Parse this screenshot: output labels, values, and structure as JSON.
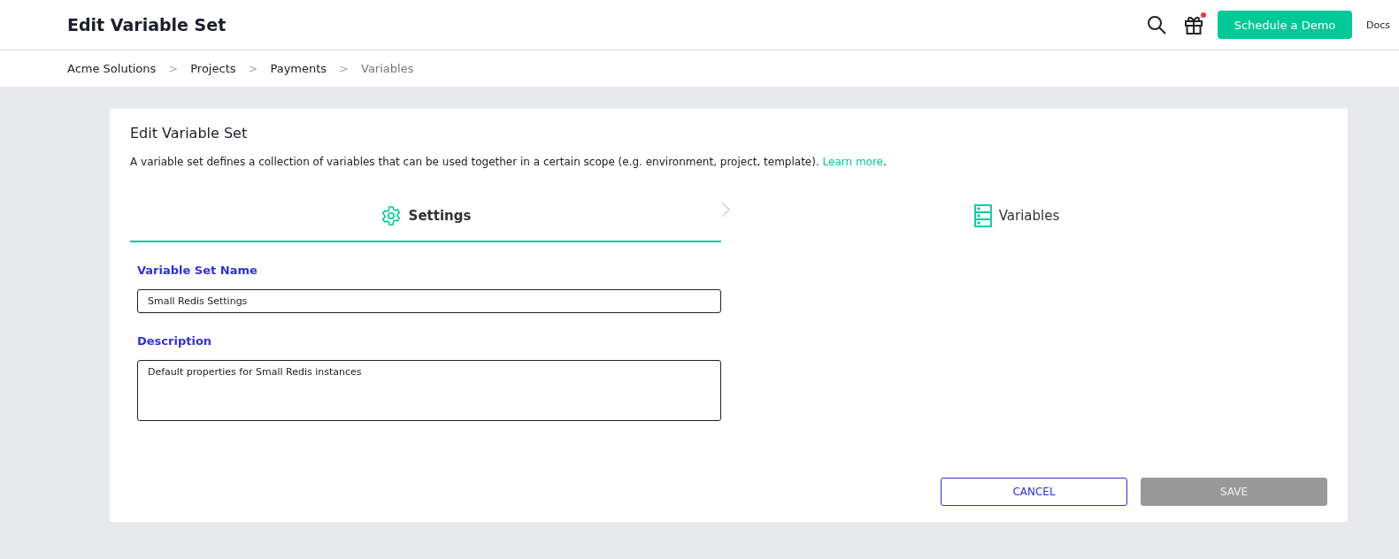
{
  "header": {
    "title": "Edit Variable Set",
    "schedule_button": "Schedule a Demo",
    "docs_link": "Docs",
    "gift_notification": true
  },
  "breadcrumbs": [
    {
      "label": "Acme Solutions",
      "current": false
    },
    {
      "label": "Projects",
      "current": false
    },
    {
      "label": "Payments",
      "current": false
    },
    {
      "label": "Variables",
      "current": true
    }
  ],
  "breadcrumb_separator": ">",
  "card": {
    "title": "Edit Variable Set",
    "description": "A variable set defines a collection of variables that can be used together in a certain scope (e.g. environment, project, template).",
    "learn_more": "Learn more",
    "after_link": "."
  },
  "steps": [
    {
      "label": "Settings",
      "kind": "settings",
      "selected": true
    },
    {
      "label": "Variables",
      "kind": "variables",
      "selected": false
    }
  ],
  "fields": [
    {
      "label": "Variable Set Name",
      "kind": "input",
      "value": "Small Redis Settings"
    },
    {
      "label": "Description",
      "kind": "textarea",
      "value": "Default properties for Small Redis instances"
    }
  ],
  "buttons": {
    "cancel": {
      "label": "CANCEL",
      "disabled": false
    },
    "save": {
      "label": "SAVE",
      "disabled": true
    }
  }
}
